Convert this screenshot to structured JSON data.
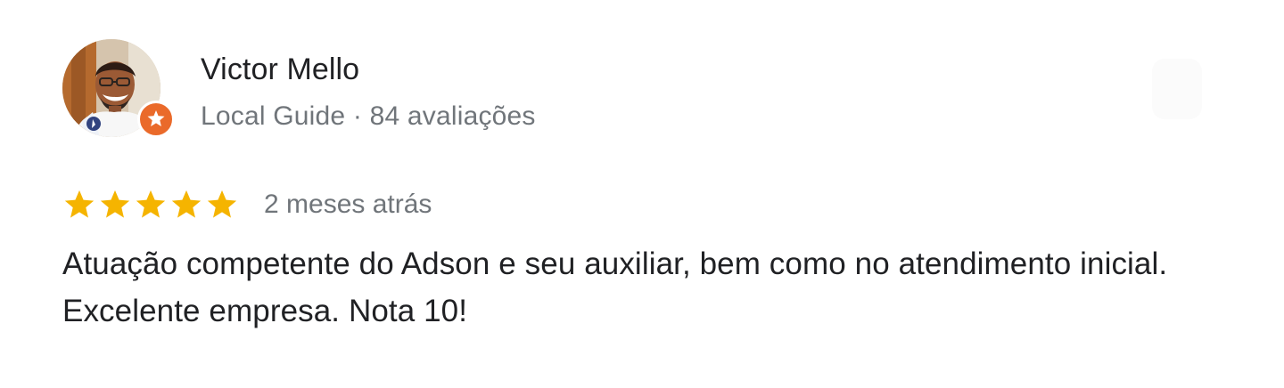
{
  "review": {
    "author_name": "Victor Mello",
    "author_meta": "Local Guide · 84 avaliações",
    "rating": 5,
    "max_rating": 5,
    "time_ago": "2 meses atrás",
    "text": "Atuação competente do Adson e seu auxiliar, bem como no atendimento inicial. Excelente empresa. Nota 10!"
  },
  "icons": {
    "avatar": "profile-photo",
    "badge": "local-guide-star-icon",
    "rating": "star-icon",
    "menu": "more-options-icon"
  },
  "colors": {
    "star": "#f5b400",
    "guide_badge": "#ea6a2a",
    "name_text": "#202124",
    "secondary_text": "#70757a",
    "review_text": "#202124",
    "background": "#ffffff"
  }
}
